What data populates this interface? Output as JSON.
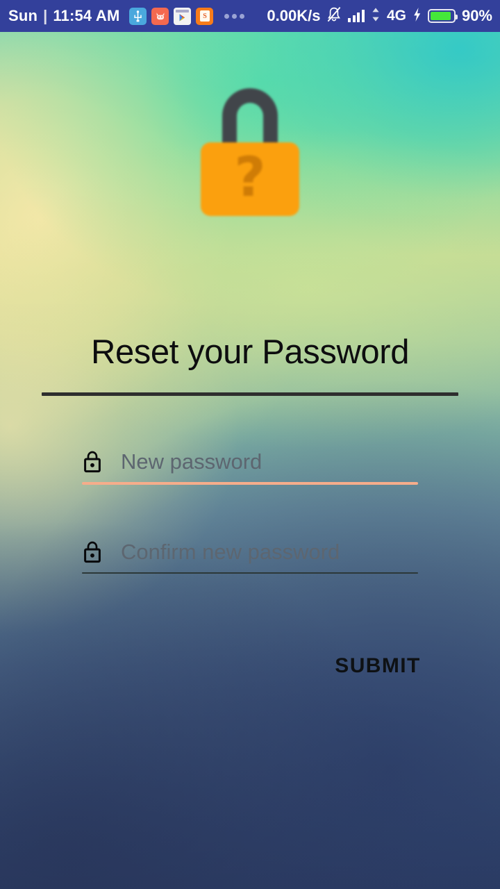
{
  "status_bar": {
    "day": "Sun",
    "separator": "|",
    "time": "11:54 AM",
    "network_speed": "0.00K/s",
    "network_type": "4G",
    "battery_percent": "90%",
    "battery_fill_percent": 90,
    "signal_bars": 4,
    "overflow_dots": "...",
    "background_color": "#33409B",
    "text_color": "#FFFFFF",
    "battery_color": "#45E83A",
    "app_icons": [
      {
        "name": "usb-icon",
        "label": "USB"
      },
      {
        "name": "app-face-icon",
        "label": ""
      },
      {
        "name": "play-store-icon",
        "label": ""
      },
      {
        "name": "app-orange-icon",
        "label": "S"
      }
    ],
    "icons": [
      "mute-bell-icon",
      "signal-bars-icon",
      "data-transfer-icon",
      "charging-bolt-icon",
      "battery-icon"
    ]
  },
  "hero": {
    "icon_name": "forgot-password-padlock",
    "question_mark": "?",
    "body_color": "#FBA00E",
    "question_color": "#CF7C06",
    "shackle_color": "#41454A"
  },
  "main": {
    "title": "Reset your Password",
    "divider_color": "#2E2E2E",
    "fields": [
      {
        "name": "new-password",
        "placeholder": "New password",
        "value": "",
        "icon": "lock-icon",
        "underline_color": "#F6AD8B",
        "focused": true
      },
      {
        "name": "confirm-new-password",
        "placeholder": "Confirm new password",
        "value": "",
        "icon": "lock-icon",
        "underline_color": "#2C3838",
        "focused": false
      }
    ],
    "submit_label": "SUBMIT"
  },
  "theme": {
    "accent": "#F6AD8B",
    "title_color": "#0D0D0F",
    "placeholder_color": "#5D6670",
    "bg_top_left": "#F0E2A0",
    "bg_top_center": "#4FDBA8",
    "bg_top_right": "#28C6C4",
    "bg_bottom": "#2E4069"
  }
}
